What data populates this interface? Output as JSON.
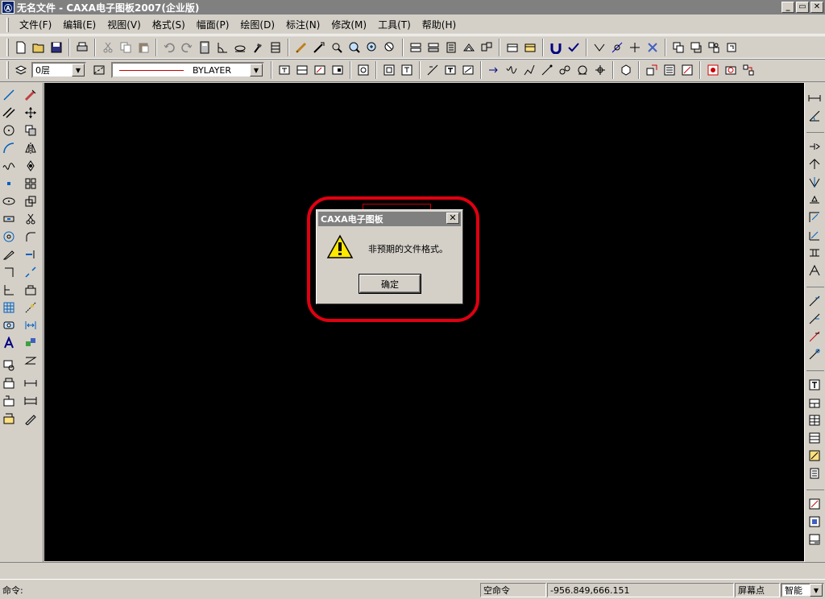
{
  "window": {
    "title": "无名文件 - CAXA电子图板2007(企业版)",
    "app_icon": "Ⓐ",
    "min": "_",
    "max": "▭",
    "close": "✕"
  },
  "menu": [
    "文件(F)",
    "编辑(E)",
    "视图(V)",
    "格式(S)",
    "幅面(P)",
    "绘图(D)",
    "标注(N)",
    "修改(M)",
    "工具(T)",
    "帮助(H)"
  ],
  "properties": {
    "layer": "0层",
    "linetype": "BYLAYER"
  },
  "dialog": {
    "title": "CAXA电子图板",
    "message": "非预期的文件格式。",
    "ok": "确定",
    "close": "✕"
  },
  "status": {
    "command_prompt": "命令:",
    "state": "空命令",
    "coords": "-956.849,666.151",
    "snap_label": "屏幕点",
    "snap_mode": "智能"
  },
  "colors": {
    "canvas": "#000000",
    "highlight": "#e00010",
    "titlebar": "#808080"
  }
}
